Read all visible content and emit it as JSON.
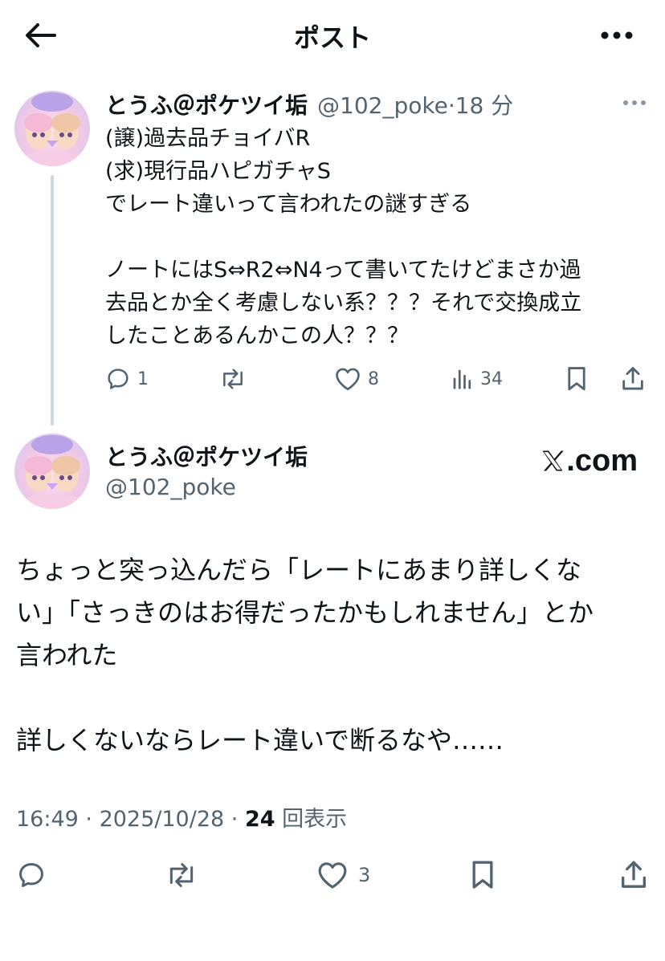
{
  "header": {
    "title": "ポスト",
    "back_icon": "arrow-left-icon",
    "more_icon": "more-horizontal-icon"
  },
  "reply_post": {
    "display_name": "とうふ＠ポケツイ垢",
    "handle": "@102_poke",
    "separator": "·",
    "time": "18 分",
    "lines": [
      "(譲)過去品チョイバR",
      "(求)現行品ハピガチャS",
      "でレート違いって言われたの謎すぎる",
      "",
      "ノートにはS⇔R2⇔N4って書いてたけどまさか過",
      "去品とか全く考慮しない系？？？それで交換成立",
      "したことあるんかこの人？？？"
    ],
    "actions": {
      "reply_count": "1",
      "repost_count": "",
      "like_count": "8",
      "views_count": "34"
    }
  },
  "main_post": {
    "display_name": "とうふ＠ポケツイ垢",
    "handle": "@102_poke",
    "source_label": ".com",
    "lines": [
      "ちょっと突っ込んだら「レートにあまり詳しくな",
      "い」「さっきのはお得だったかもしれません」とか",
      "言われた",
      "",
      "詳しくないならレート違いで断るなや……"
    ],
    "meta": {
      "time": "16:49",
      "sep1": " · ",
      "date": "2025/10/28",
      "sep2": " · ",
      "views": "24",
      "views_label": " 回表示"
    },
    "actions": {
      "like_count": "3"
    }
  },
  "colors": {
    "text": "#0f1419",
    "secondary": "#536471",
    "thread_line": "#cfd9de"
  }
}
